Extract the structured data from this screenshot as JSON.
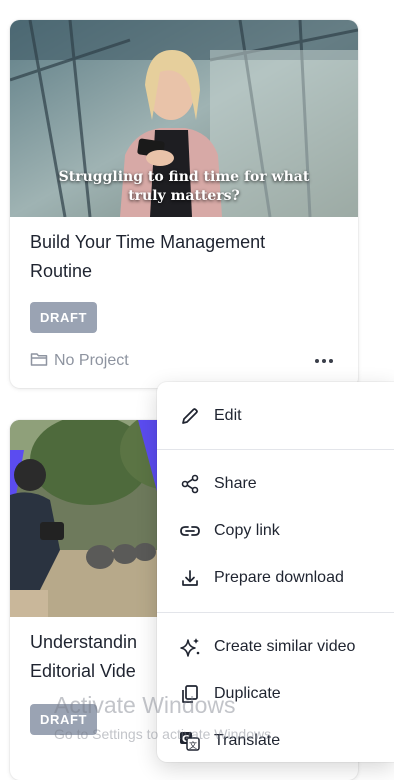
{
  "cards": [
    {
      "thumbnail_caption_line1": "Struggling to find time for what",
      "thumbnail_caption_line2": "truly matters?",
      "title": "Build Your Time Management Routine",
      "status": "DRAFT",
      "project": "No Project"
    },
    {
      "title_line1": "Understandin",
      "title_line2": "Editorial Vide",
      "status": "DRAFT"
    }
  ],
  "menu": {
    "items": [
      {
        "label": "Edit",
        "icon": "pencil-icon"
      },
      {
        "label": "Share",
        "icon": "share-icon"
      },
      {
        "label": "Copy link",
        "icon": "link-icon"
      },
      {
        "label": "Prepare download",
        "icon": "download-icon"
      },
      {
        "label": "Create similar video",
        "icon": "sparkle-icon"
      },
      {
        "label": "Duplicate",
        "icon": "duplicate-icon"
      },
      {
        "label": "Translate",
        "icon": "translate-icon"
      }
    ]
  },
  "watermark": {
    "line1": "Activate Windows",
    "line2": "Go to Settings to activate Windows."
  }
}
